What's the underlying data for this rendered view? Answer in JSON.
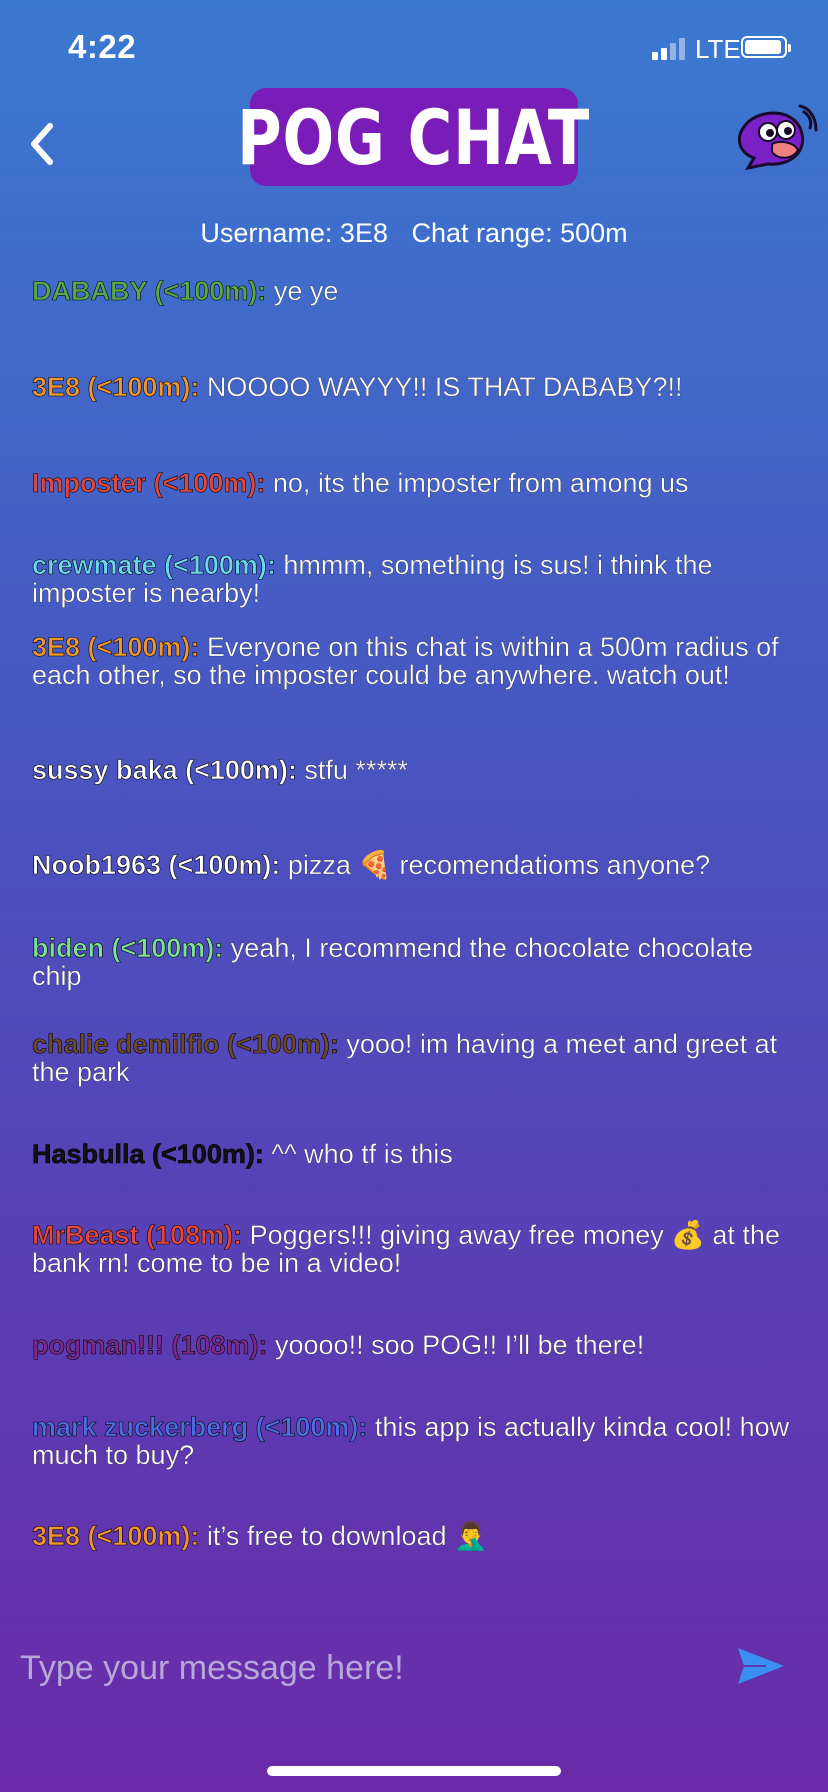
{
  "status_bar": {
    "time": "4:22",
    "carrier": "LTE"
  },
  "header": {
    "title": "POG CHAT",
    "logo_color": "#7a1cb8",
    "back_icon": "chevron-left-icon",
    "mascot_icon": "purple-bird-mascot-icon"
  },
  "info": {
    "username": "Username: 3E8",
    "range": "Chat range: 500m"
  },
  "messages": [
    {
      "name": "DABABY (<100m):",
      "text": " ye ye",
      "color": "#5aa84a"
    },
    {
      "name": "3E8 (<100m):",
      "text": " NOOOO WAYYY!! IS THAT DABABY?!!",
      "color": "#f0962e"
    },
    {
      "name": "Imposter (<100m):",
      "text": " no, its the imposter from among us",
      "color": "#e2473a"
    },
    {
      "name": "crewmate (<100m):",
      "text": " hmmm, something is sus! i think the imposter is nearby!",
      "color": "#6cd6f0"
    },
    {
      "name": "3E8 (<100m):",
      "text": " Everyone on this chat is within a 500m radius of each other, so the imposter could be anywhere. watch out!",
      "color": "#f0962e"
    },
    {
      "name": "sussy baka (<100m):",
      "text": " stfu *****",
      "color": "#ffffff"
    },
    {
      "name": "Noob1963 (<100m):",
      "text": " pizza 🍕 recomendatioms anyone?",
      "color": "#ffffff"
    },
    {
      "name": "biden (<100m):",
      "text": " yeah, I recommend the chocolate chocolate chip",
      "color": "#7fe09a"
    },
    {
      "name": "chalie demilfio (<100m):",
      "text": " yooo! im having a meet and greet at the park",
      "color": "#6b4a2c"
    },
    {
      "name": "Hasbulla (<100m):",
      "text": " ^^ who tf is this",
      "color": "#111111"
    },
    {
      "name": "MrBeast (108m):",
      "text": " Poggers!!! giving away free money 💰 at the bank rn! come to be in a video!",
      "color": "#e2473a"
    },
    {
      "name": "pogman!!! (108m):",
      "text": " yoooo!! soo POG!! I’ll be there!",
      "color": "#7a2a8a"
    },
    {
      "name": "mark zuckerberg (<100m):",
      "text": " this app is actually kinda cool! how much to buy?",
      "color": "#4a6ee0"
    },
    {
      "name": "3E8 (<100m):",
      "text": " it’s free to download 🤦‍♂️",
      "color": "#f0962e"
    }
  ],
  "composer": {
    "placeholder": "Type your message here!",
    "send_icon": "send-icon",
    "send_color": "#3a8ff0"
  }
}
